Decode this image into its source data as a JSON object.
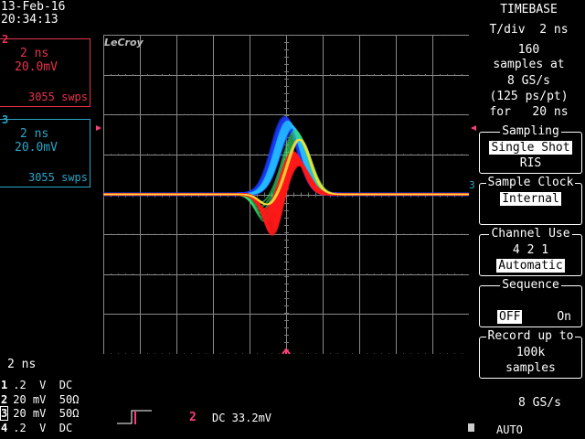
{
  "status": {
    "date": "13-Feb-16",
    "time": "20:34:13"
  },
  "channels": [
    {
      "id": "2",
      "timebase": "2 ns",
      "volts": "20.0mV",
      "sweeps": "3055 swps",
      "color": "#e8324a"
    },
    {
      "id": "3",
      "timebase": "2 ns",
      "volts": "20.0mV",
      "sweeps": "3055 swps",
      "color": "#2aa6c8"
    }
  ],
  "brand": "LeCroy",
  "timebase": {
    "title": "TIMEBASE",
    "tdiv": "T/div  2 ns",
    "info_lines": [
      "160",
      "samples at",
      "8 GS/s",
      "(125 ps/pt)",
      "for   20 ns"
    ]
  },
  "menus": {
    "sampling": {
      "title": "Sampling",
      "selected": "Single Shot",
      "other": "RIS"
    },
    "sample_clock": {
      "title": "Sample Clock",
      "selected": "Internal"
    },
    "channel_use": {
      "title": "Channel Use",
      "options": "4   2   1",
      "selected": "Automatic"
    },
    "sequence": {
      "title": "Sequence",
      "off_label": "OFF",
      "on_label": "On"
    },
    "record": {
      "title": "Record up to",
      "line1": "100k",
      "line2": "samples"
    }
  },
  "footer": {
    "timediv": "2 ns",
    "traces": [
      {
        "num": "1",
        "text": ".2  V  DC"
      },
      {
        "num": "2",
        "text": "20 mV  50Ω"
      },
      {
        "num": "3",
        "text": "20 mV  50Ω"
      },
      {
        "num": "4",
        "text": ".2  V  DC"
      }
    ],
    "trigger_channel": "2",
    "trigger_info": "DC 33.2mV",
    "sample_rate": "8 GS/s",
    "trigger_mode": "AUTO"
  },
  "colors": {
    "accent_red": "#e8324a",
    "accent_cyan": "#2aa6c8",
    "trigger_pink": "#ff3c78"
  }
}
